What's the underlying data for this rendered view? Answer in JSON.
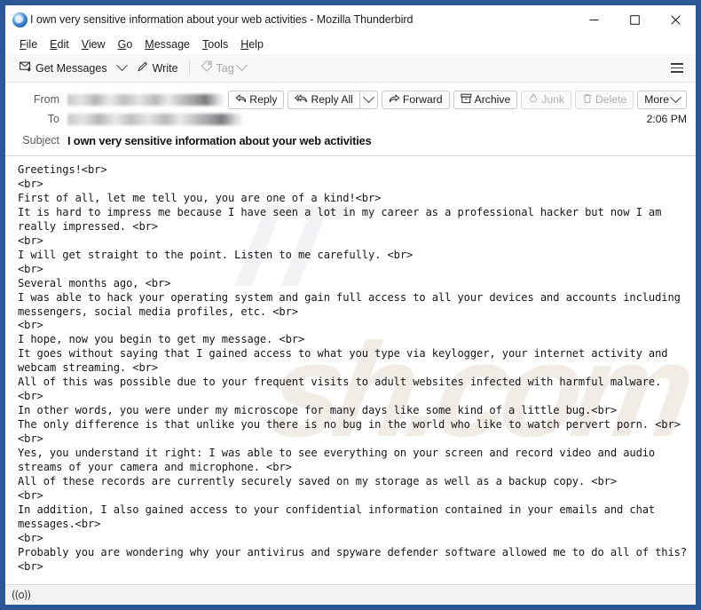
{
  "window": {
    "title": "I own very sensitive information about your web activities - Mozilla Thunderbird",
    "logo_icon": "thunderbird-logo-icon",
    "frame_color": "#2b5797",
    "controls": {
      "minimize": "minimize-icon",
      "maximize": "maximize-icon",
      "close": "close-icon"
    }
  },
  "menubar": {
    "items": [
      {
        "label": "File",
        "accel": "F",
        "rest": "ile"
      },
      {
        "label": "Edit",
        "accel": "E",
        "rest": "dit"
      },
      {
        "label": "View",
        "accel": "V",
        "rest": "iew"
      },
      {
        "label": "Go",
        "accel": "G",
        "rest": "o"
      },
      {
        "label": "Message",
        "accel": "M",
        "rest": "essage"
      },
      {
        "label": "Tools",
        "accel": "T",
        "rest": "ools"
      },
      {
        "label": "Help",
        "accel": "H",
        "rest": "elp"
      }
    ]
  },
  "toolbar": {
    "get_messages_label": "Get Messages",
    "get_messages_icon": "envelope-download-icon",
    "get_messages_dropdown_icon": "chevron-down-icon",
    "write_label": "Write",
    "write_icon": "pencil-icon",
    "tag_label": "Tag",
    "tag_icon": "tag-icon",
    "tag_dropdown_icon": "chevron-down-icon",
    "tag_disabled": true,
    "app_menu_icon": "hamburger-menu-icon"
  },
  "message": {
    "from_label": "From",
    "from_value": "",
    "to_label": "To",
    "to_value": "",
    "subject_label": "Subject",
    "subject_value": "I own very sensitive information about your web activities",
    "time": "2:06 PM",
    "actions": [
      {
        "label": "Reply",
        "icon": "reply-icon",
        "disabled": false
      },
      {
        "label": "Reply All",
        "icon": "reply-all-icon",
        "disabled": false
      },
      {
        "label": "Forward",
        "icon": "forward-icon",
        "disabled": false
      },
      {
        "label": "Archive",
        "icon": "archive-box-icon",
        "disabled": false
      },
      {
        "label": "Junk",
        "icon": "flame-icon",
        "disabled": true
      },
      {
        "label": "Delete",
        "icon": "trash-icon",
        "disabled": true
      },
      {
        "label": "More",
        "icon": "chevron-down-icon",
        "disabled": false
      }
    ],
    "body": "Greetings!<br>\n<br>\nFirst of all, let me tell you, you are one of a kind!<br>\nIt is hard to impress me because I have seen a lot in my career as a professional hacker but now I am really impressed. <br>\n<br>\nI will get straight to the point. Listen to me carefully. <br>\n<br>\nSeveral months ago, <br>\nI was able to hack your operating system and gain full access to all your devices and accounts including messengers, social media profiles, etc. <br>\n<br>\nI hope, now you begin to get my message. <br>\nIt goes without saying that I gained access to what you type via keylogger, your internet activity and webcam streaming. <br>\nAll of this was possible due to your frequent visits to adult websites infected with harmful malware. <br>\nIn other words, you were under my microscope for many days like some kind of a little bug.<br>\nThe only difference is that unlike you there is no bug in the world who like to watch pervert porn. <br>\n<br>\nYes, you understand it right: I was able to see everything on your screen and record video and audio streams of your camera and microphone. <br>\nAll of these records are currently securely saved on my storage as well as a backup copy. <br>\n<br>\nIn addition, I also gained access to your confidential information contained in your emails and chat messages.<br>\n<br>\nProbably you are wondering why your antivirus and spyware defender software allowed me to do all of this? <br>"
  },
  "watermark": {
    "front_text": "sh.com",
    "back_text": "IT"
  },
  "statusbar": {
    "icon": "((o))",
    "icon_name": "broadcast-signal-icon"
  }
}
